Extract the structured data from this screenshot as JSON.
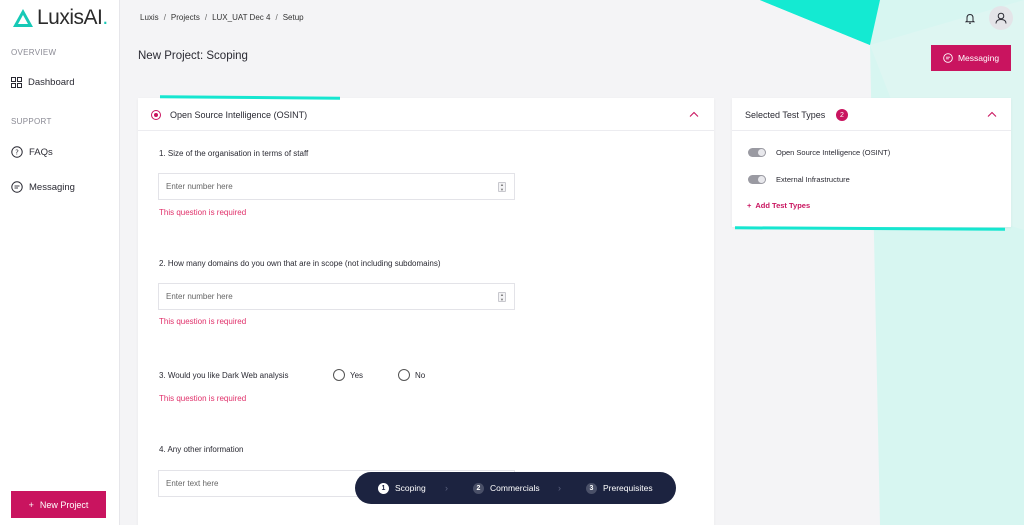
{
  "brand": {
    "name": "LuxisAI",
    "name_main": "LuxisAI",
    "name_dot": ".",
    "accent": "#c9145f",
    "teal": "#16e6d0"
  },
  "sidebar": {
    "section_overview": "OVERVIEW",
    "section_support": "SUPPORT",
    "items": [
      {
        "label": "Dashboard",
        "icon": "grid-icon"
      },
      {
        "label": "FAQs",
        "icon": "question-circle-icon"
      },
      {
        "label": "Messaging",
        "icon": "chat-bubble-icon"
      }
    ],
    "new_project_label": "New Project"
  },
  "header": {
    "breadcrumb": [
      "Luxis",
      "Projects",
      "LUX_UAT Dec 4",
      "Setup"
    ],
    "page_title": "New Project: Scoping",
    "messaging_label": "Messaging"
  },
  "main": {
    "section_title": "Open Source Intelligence (OSINT)",
    "questions": [
      {
        "label": "1. Size of the organisation in terms of staff",
        "placeholder": "Enter number here",
        "error": "This question is required"
      },
      {
        "label": "2. How many domains do you own that are in scope (not including subdomains)",
        "placeholder": "Enter number here",
        "error": "This question is required"
      },
      {
        "label": "3. Would you like Dark Web analysis",
        "options": [
          "Yes",
          "No"
        ],
        "error": "This question is required"
      },
      {
        "label": "4. Any other information",
        "placeholder": "Enter text here"
      }
    ]
  },
  "stepper": {
    "steps": [
      {
        "num": "1",
        "label": "Scoping",
        "active": true
      },
      {
        "num": "2",
        "label": "Commercials",
        "active": false
      },
      {
        "num": "3",
        "label": "Prerequisites",
        "active": false
      }
    ]
  },
  "side_panel": {
    "title": "Selected Test Types",
    "count": "2",
    "items": [
      "Open Source Intelligence (OSINT)",
      "External Infrastructure"
    ],
    "add_label": "Add Test Types"
  }
}
